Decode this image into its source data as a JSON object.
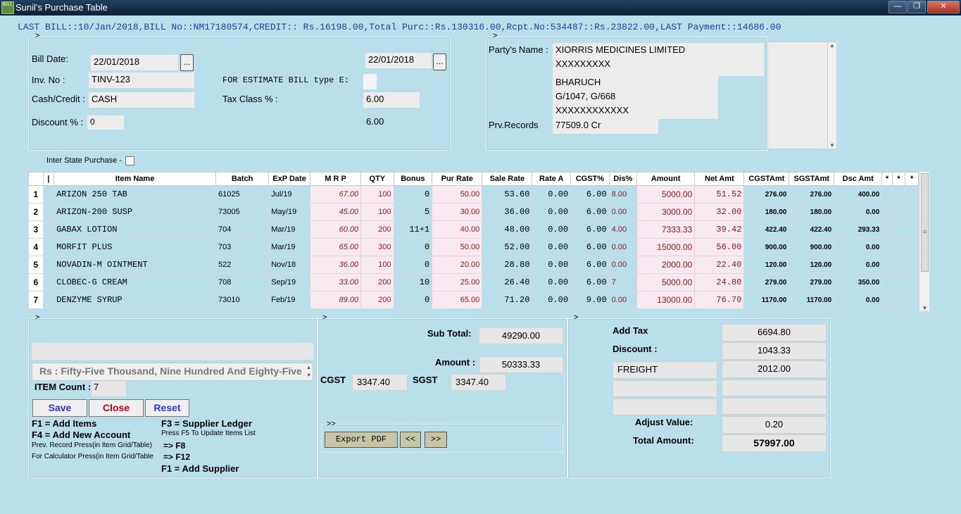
{
  "window": {
    "title": "Sunil's Purchase Table",
    "icon_text": "BILL"
  },
  "last_bill": "LAST BILL::10/Jan/2018,BILL No::NM17180574,CREDIT:: Rs.16198.00,Total Purc::Rs.130316.00,Rcpt.No:534487::Rs.23822.00,LAST Payment::14686.00",
  "bill": {
    "bill_date_label": "Bill Date:",
    "bill_date": "22/01/2018",
    "date2": "22/01/2018",
    "dots": "...",
    "inv_label": "Inv. No :",
    "inv_no": "TINV-123",
    "estimate_label": "FOR ESTIMATE BILL type E:",
    "estimate_value": "",
    "cash_credit_label": "Cash/Credit :",
    "cash_credit": "CASH",
    "tax_class_label": "Tax Class % :",
    "tax_class": "6.00",
    "discount_label": "Discount % :",
    "discount": "0",
    "discount2": "6.00"
  },
  "party": {
    "name_label": "Party's Name :",
    "name": "XIORRIS MEDICINES LIMITED",
    "line2": "XXXXXXXXX",
    "city": "BHARUCH",
    "address": "G/1047, G/668",
    "line5": "XXXXXXXXXXXX",
    "prv_label": "Prv.Records",
    "prv_value": "77509.0 Cr"
  },
  "inter_state_label": "Inter State Purchase -",
  "chevron": ">",
  "grid": {
    "headers": [
      "",
      "|",
      "Item Name",
      "Batch",
      "ExP Date",
      "M R P",
      "QTY",
      "Bonus",
      "Pur Rate",
      "Sale Rate",
      "Rate A",
      "CGST%",
      "Dis%",
      "Amount",
      "Net Amt",
      "CGSTAmt",
      "SGSTAmt",
      "Dsc Amt",
      "*",
      "*",
      "*"
    ],
    "rows": [
      [
        "1",
        "",
        "ARIZON 250 TAB",
        "61025",
        "Jul/19",
        "67.00",
        "100",
        "0",
        "50.00",
        "53.60",
        "0.00",
        "6.00",
        "8.00",
        "5000.00",
        "51.52",
        "276.00",
        "276.00",
        "400.00",
        "",
        "",
        ""
      ],
      [
        "2",
        "",
        "ARIZON-200 SUSP",
        "73005",
        "May/19",
        "45.00",
        "100",
        "5",
        "30.00",
        "36.00",
        "0.00",
        "6.00",
        "0.00",
        "3000.00",
        "32.00",
        "180.00",
        "180.00",
        "0.00",
        "",
        "",
        ""
      ],
      [
        "3",
        "",
        "GABAX LOTION",
        "704",
        "Mar/19",
        "60.00",
        "200",
        "11+1",
        "40.00",
        "48.00",
        "0.00",
        "6.00",
        "4.00",
        "7333.33",
        "39.42",
        "422.40",
        "422.40",
        "293.33",
        "",
        "",
        ""
      ],
      [
        "4",
        "",
        "MORFIT PLUS",
        "703",
        "Mar/19",
        "65.00",
        "300",
        "0",
        "50.00",
        "52.00",
        "0.00",
        "6.00",
        "0.00",
        "15000.00",
        "56.00",
        "900.00",
        "900.00",
        "0.00",
        "",
        "",
        ""
      ],
      [
        "5",
        "",
        "NOVADIN-M OINTMENT",
        "522",
        "Nov/18",
        "36.00",
        "100",
        "0",
        "20.00",
        "28.80",
        "0.00",
        "6.00",
        "0.00",
        "2000.00",
        "22.40",
        "120.00",
        "120.00",
        "0.00",
        "",
        "",
        ""
      ],
      [
        "6",
        "",
        "CLOBEC-G CREAM",
        "708",
        "Sep/19",
        "33.00",
        "200",
        "10",
        "25.00",
        "26.40",
        "0.00",
        "6.00",
        "7",
        "5000.00",
        "24.80",
        "279.00",
        "279.00",
        "350.00",
        "",
        "",
        ""
      ],
      [
        "7",
        "",
        "DENZYME SYRUP",
        "73010",
        "Feb/19",
        "89.00",
        "200",
        "0",
        "65.00",
        "71.20",
        "0.00",
        "9.00",
        "0.00",
        "13000.00",
        "76.70",
        "1170.00",
        "1170.00",
        "0.00",
        "",
        "",
        ""
      ]
    ]
  },
  "summary_left": {
    "amount_words": "Rs : Fifty-Five Thousand, Nine Hundred And Eighty-Five",
    "item_count_label": "ITEM Count :",
    "item_count": "7",
    "save": "Save",
    "close": "Close",
    "reset": "Reset",
    "help": {
      "f1": "F1 = Add Items",
      "f3": "F3 = Supplier Ledger",
      "f4": "F4 = Add New Account",
      "f5": "Press F5 To Update Items List",
      "prev": "Prev. Record Press(in Item Grid/Table)",
      "f8": "=> F8",
      "calc": "For Calculator Press(in Item Grid/Table",
      "f12": "=> F12",
      "f1_supplier": "F1 = Add Supplier"
    }
  },
  "summary_mid": {
    "sub_total_label": "Sub Total:",
    "sub_total": "49290.00",
    "amount_label": "Amount :",
    "amount": "50333.33",
    "cgst_label": "CGST",
    "cgst": "3347.40",
    "sgst_label": "SGST",
    "sgst": "3347.40",
    "export_chev": ">>",
    "export_pdf": "Export PDF",
    "prev_btn": "<<",
    "next_btn": ">>"
  },
  "summary_right": {
    "add_tax_label": "Add Tax",
    "add_tax": "6694.80",
    "discount_label": "Discount :",
    "discount": "1043.33",
    "freight_label": "FREIGHT",
    "freight": "2012.00",
    "adjust_label": "Adjust Value:",
    "adjust": "0.20",
    "total_label": "Total Amount:",
    "total": "57997.00"
  }
}
